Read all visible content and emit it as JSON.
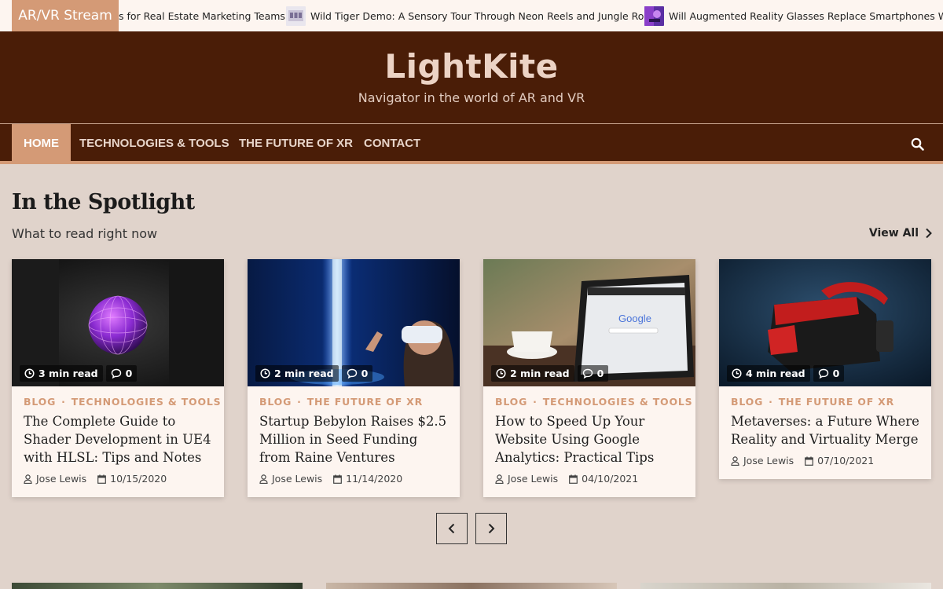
{
  "ticker": {
    "label": "AR/VR Stream",
    "items": [
      {
        "title": "s for Real Estate Marketing Teams"
      },
      {
        "title": "Wild Tiger Demo: A Sensory Tour Through Neon Reels and Jungle Roars",
        "thumb_icon": "slot-machine-thumbnail"
      },
      {
        "title": "Will Augmented Reality Glasses Replace Smartphones Wit",
        "thumb_icon": "ar-glasses-thumbnail"
      }
    ]
  },
  "header": {
    "title": "LightKite",
    "tagline": "Navigator in the world of AR and VR"
  },
  "nav": {
    "items": [
      {
        "label": "Home",
        "active": true
      },
      {
        "label": "Technologies & Tools"
      },
      {
        "label": "The Future of XR"
      },
      {
        "label": "Contact"
      }
    ],
    "search_icon": "search-icon"
  },
  "section": {
    "title": "In the Spotlight",
    "subtitle": "What to read right now",
    "view_all": "View All"
  },
  "cards": [
    {
      "read_time": "3 min read",
      "comments": "0",
      "cat1": "Blog",
      "cat2": "Technologies & Tools",
      "title": "The Complete Guide to Shader Development in UE4 with HLSL: Tips and Notes",
      "author": "Jose Lewis",
      "date": "10/15/2020"
    },
    {
      "read_time": "2 min read",
      "comments": "0",
      "cat1": "Blog",
      "cat2": "The Future of XR",
      "title": "Startup Bebylon Raises $2.5 Million in Seed Funding from Raine Ventures",
      "author": "Jose Lewis",
      "date": "11/14/2020"
    },
    {
      "read_time": "2 min read",
      "comments": "0",
      "cat1": "Blog",
      "cat2": "Technologies & Tools",
      "title": "How to Speed Up Your Website Using Google Analytics: Practical Tips",
      "author": "Jose Lewis",
      "date": "04/10/2021"
    },
    {
      "read_time": "4 min read",
      "comments": "0",
      "cat1": "Blog",
      "cat2": "The Future of XR",
      "title": "Metaverses: a Future Where Reality and Virtuality Merge",
      "author": "Jose Lewis",
      "date": "07/10/2021"
    }
  ],
  "colors": {
    "accent": "#d49a76",
    "header_bg": "#4a1d07",
    "page_bg": "#e0d3cb",
    "card_bg": "#fdf5f0"
  }
}
